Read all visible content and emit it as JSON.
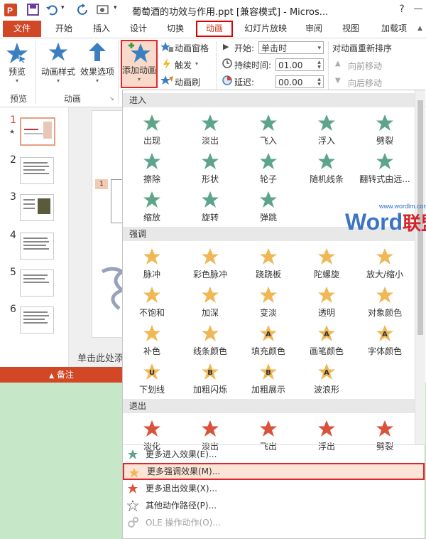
{
  "title_bar": {
    "title": "葡萄酒的功效与作用.ppt [兼容模式] - Micros...",
    "help": "?",
    "minimize": "—",
    "restore": "□"
  },
  "tabs": [
    {
      "label": "文件"
    },
    {
      "label": "开始"
    },
    {
      "label": "插入"
    },
    {
      "label": "设计"
    },
    {
      "label": "切换"
    },
    {
      "label": "动画"
    },
    {
      "label": "幻灯片放映"
    },
    {
      "label": "审阅"
    },
    {
      "label": "视图"
    },
    {
      "label": "加载项"
    }
  ],
  "ribbon": {
    "preview": "预览",
    "anim_style": "动画样式",
    "effect_options": "效果选项",
    "add_animation": "添加动画",
    "anim_pane": "动画窗格",
    "trigger": "触发",
    "anim_brush": "动画刷",
    "start_label": "开始:",
    "start_value": "单击时",
    "duration_label": "持续时间:",
    "duration_value": "01.00",
    "delay_label": "延迟:",
    "delay_value": "00.00",
    "reorder_label": "对动画重新排序",
    "move_forward": "向前移动",
    "move_backward": "向后移动",
    "group_preview": "预览",
    "group_animation": "动画"
  },
  "slides": [
    "1",
    "2",
    "3",
    "4",
    "5",
    "6"
  ],
  "slide_tag": "1",
  "slide_placeholder": "单击此处添",
  "notes_label": "备注",
  "dropdown": {
    "sections": {
      "entrance": "进入",
      "emphasis": "强调",
      "exit": "退出"
    },
    "entrance": [
      "出现",
      "淡出",
      "飞入",
      "浮入",
      "劈裂",
      "擦除",
      "形状",
      "轮子",
      "随机线条",
      "翻转式由远...",
      "缩放",
      "旋转",
      "弹跳"
    ],
    "emphasis": [
      "脉冲",
      "彩色脉冲",
      "跷跷板",
      "陀螺旋",
      "放大/缩小",
      "不饱和",
      "加深",
      "变淡",
      "透明",
      "对象颜色",
      "补色",
      "线条颜色",
      "填充颜色",
      "画笔颜色",
      "字体颜色",
      "下划线",
      "加粗闪烁",
      "加粗展示",
      "波浪形"
    ],
    "exit": [
      "淡化",
      "淡出",
      "飞出",
      "浮出",
      "劈裂"
    ],
    "emphasis_letters": [
      "A",
      "A",
      "A",
      "U",
      "B",
      "B",
      "A"
    ],
    "menu": [
      "更多进入效果(E)...",
      "更多强调效果(M)...",
      "更多退出效果(X)...",
      "其他动作路径(P)...",
      "OLE 操作动作(O)..."
    ]
  },
  "watermark": {
    "brand": "Word",
    "cn": "联盟",
    "url": "www.wordlm.com"
  },
  "colors": {
    "accent": "#d24726",
    "entrance": "#5da48a",
    "emphasis": "#f0b755",
    "exit": "#d9533b",
    "highlight_border": "#e0262d"
  }
}
